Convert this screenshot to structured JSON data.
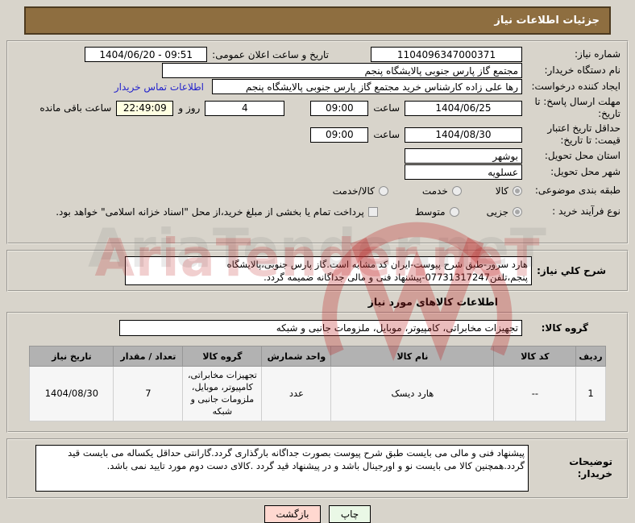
{
  "titlebar": {
    "title": "جزئیات اطلاعات نیاز"
  },
  "form": {
    "need_number_label": "شماره نیاز:",
    "need_number": "1104096347000371",
    "announce_label": "تاریخ و ساعت اعلان عمومی:",
    "announce_value": "1404/06/20 - 09:51",
    "buyer_org_label": "نام دستگاه خریدار:",
    "buyer_org": "مجتمع گاز پارس جنوبی  پالایشگاه پنجم",
    "creator_label": "ایجاد کننده درخواست:",
    "creator": "رها علی زاده کارشناس خرید مجتمع گاز پارس جنوبی  پالایشگاه پنجم",
    "contact_link": "اطلاعات تماس خریدار",
    "deadline_label": "مهلت ارسال پاسخ: تا تاریخ:",
    "deadline_date": "1404/06/25",
    "hour_label": "ساعت",
    "deadline_time": "09:00",
    "days_value": "4",
    "days_label": "روز و",
    "remaining_time": "22:49:09",
    "remaining_label": "ساعت باقی مانده",
    "validity_label": "حداقل تاریخ اعتبار قیمت: تا تاریخ:",
    "validity_date": "1404/08/30",
    "validity_time": "09:00",
    "province_label": "استان محل تحویل:",
    "province": "بوشهر",
    "city_label": "شهر محل تحویل:",
    "city": "عسلویه",
    "classification_label": "طبقه بندی موضوعی:",
    "cls_goods": "کالا",
    "cls_service": "خدمت",
    "cls_both": "کالا/خدمت",
    "process_label": "نوع فرآیند خرید :",
    "process_partial": "جزیی",
    "process_medium": "متوسط",
    "treasury_note": "پرداخت تمام یا بخشی از مبلغ خرید،از محل \"اسناد خزانه اسلامی\" خواهد بود."
  },
  "description": {
    "label": "شرح کلي نیاز:",
    "text": "هارد سرور-طبق شرح پیوست-ایران کد مشابه است.گاز پارس جنوبی،پالایشگاه پنجم،تلفن07731317247-پیشنهاد فنی و مالی جداگانه ضمیمه گردد."
  },
  "goods_heading": "اطلاعات کالاهای مورد نیاز",
  "goods": {
    "group_label": "گروه کالا:",
    "group_value": "تجهیزات مخابراتی، کامپیوتر، موبایل، ملزومات جانبی و شبکه"
  },
  "table": {
    "headers": [
      "ردیف",
      "کد کالا",
      "نام کالا",
      "واحد شمارش",
      "گروه کالا",
      "تعداد / مقدار",
      "تاریخ نیاز"
    ],
    "rows": [
      [
        "1",
        "--",
        "هارد دیسک",
        "عدد",
        "تجهیزات مخابراتی، کامپیوتر، موبایل، ملزومات جانبی و شبکه",
        "7",
        "1404/08/30"
      ]
    ]
  },
  "buyer_notes": {
    "label": "توضیحات خریدار:",
    "text": "پیشنهاد فنی و مالی می بایست طبق شرح پیوست بصورت جداگانه بارگذاری گردد.گارانتی حداقل یکساله می بایست قید گردد.همچنین کالا می بایست نو و اورجینال باشد و در پیشنهاد قید گردد .کالای دست دوم مورد تایید نمی باشد."
  },
  "footer": {
    "print_label": "چاپ",
    "back_label": "بازگشت"
  },
  "watermark": {
    "text": "AriaTender.neT"
  },
  "colors": {
    "titlebar_bg": "#8e6e40",
    "page_bg": "#d8d4cb",
    "remaining_bg": "#ffffe1",
    "link": "#2222cc",
    "table_header_bg": "#b2b2b2",
    "print_btn_bg": "#eaf8e6",
    "back_btn_bg": "#ffd8d0",
    "watermark_red": "#be2323"
  }
}
